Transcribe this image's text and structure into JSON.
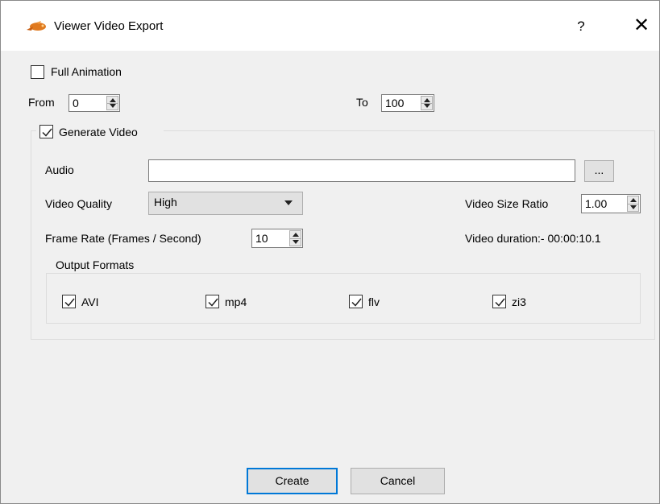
{
  "window": {
    "title": "Viewer Video Export",
    "help_label": "?",
    "close_label": "✕"
  },
  "full_animation": {
    "label": "Full Animation",
    "checked": false
  },
  "range": {
    "from_label": "From",
    "from_value": "0",
    "to_label": "To",
    "to_value": "100"
  },
  "generate_video": {
    "label": "Generate Video",
    "checked": true,
    "audio_label": "Audio",
    "audio_value": "",
    "browse_label": "...",
    "quality_label": "Video Quality",
    "quality_value": "High",
    "size_ratio_label": "Video Size Ratio",
    "size_ratio_value": "1.00",
    "frame_rate_label": "Frame Rate (Frames / Second)",
    "frame_rate_value": "10",
    "duration_text": "Video duration:- 00:00:10.1",
    "output_formats": {
      "title": "Output Formats",
      "items": [
        {
          "label": "AVI",
          "checked": true
        },
        {
          "label": "mp4",
          "checked": true
        },
        {
          "label": "flv",
          "checked": true
        },
        {
          "label": "zi3",
          "checked": true
        }
      ]
    }
  },
  "buttons": {
    "create_label": "Create",
    "cancel_label": "Cancel"
  },
  "colors": {
    "accent": "#0078d7",
    "dialog_bg": "#f0f0f0"
  }
}
